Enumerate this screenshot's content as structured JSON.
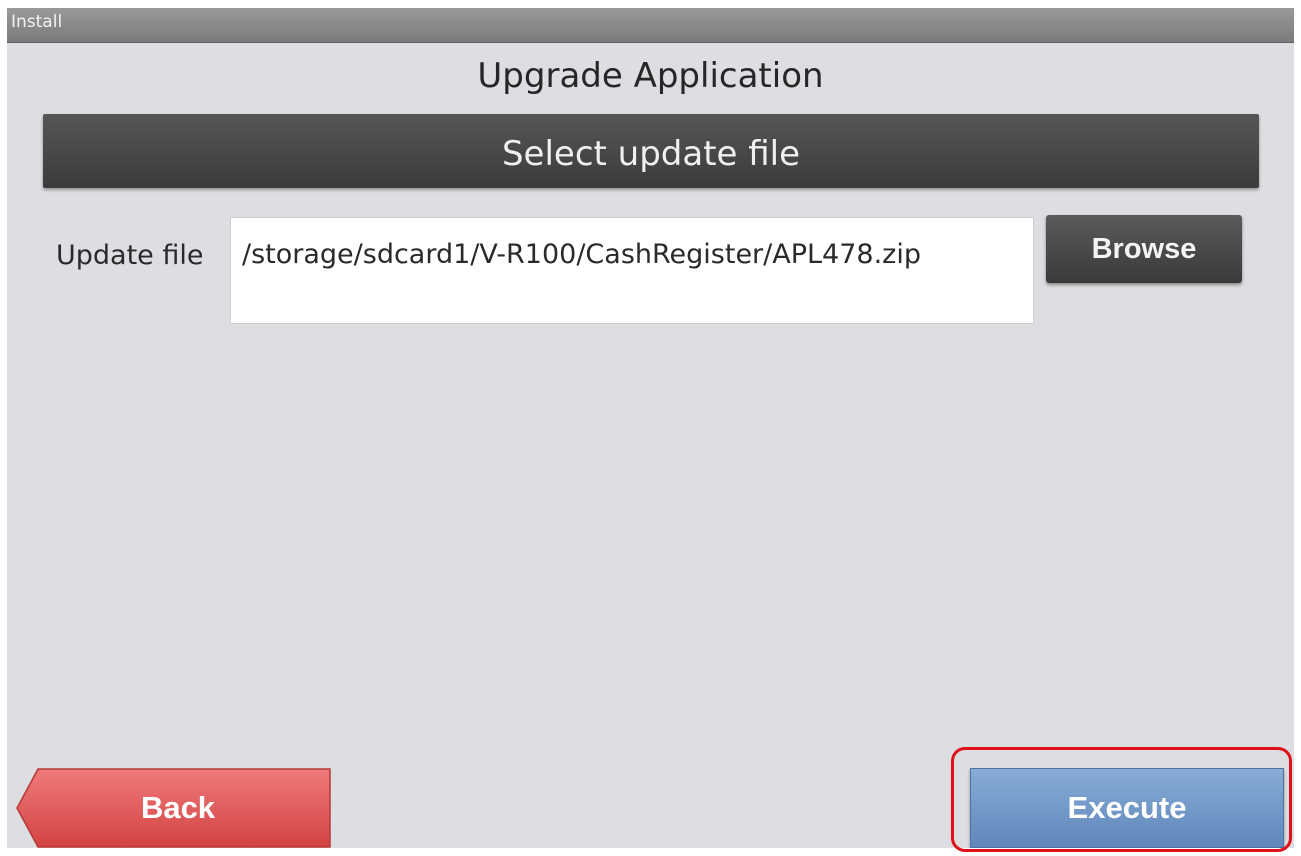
{
  "window": {
    "title": "Install"
  },
  "page": {
    "title": "Upgrade Application",
    "section_header": "Select update file"
  },
  "update_file": {
    "label": "Update file",
    "value": "/storage/sdcard1/V-R100/CashRegister/APL478.zip"
  },
  "buttons": {
    "browse": "Browse",
    "back": "Back",
    "execute": "Execute"
  },
  "colors": {
    "background": "#dcdee1",
    "section_bar": "#444444",
    "back_button": "#df5555",
    "execute_button": "#7096c8",
    "highlight": "#e0111b"
  }
}
